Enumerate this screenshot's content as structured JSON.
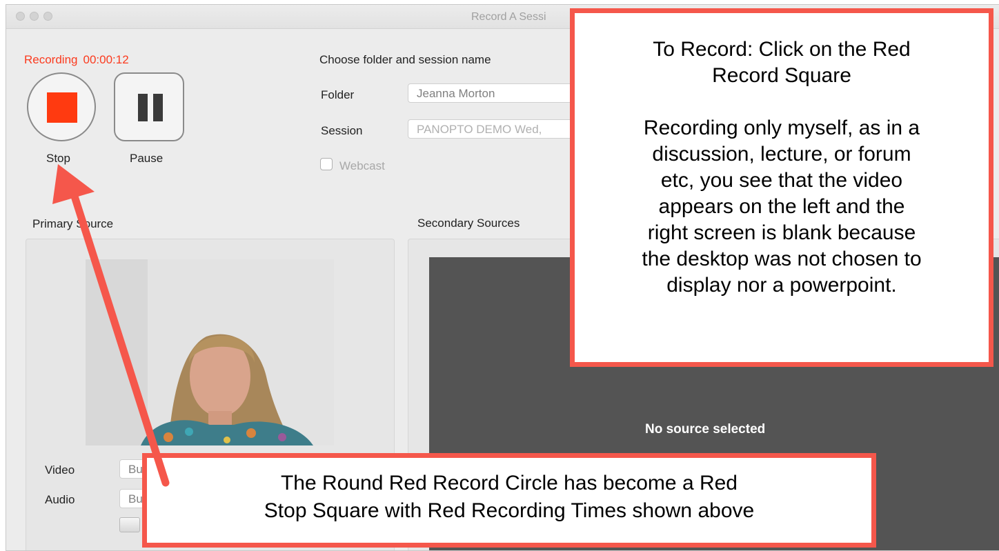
{
  "window": {
    "title": "Record A Sessi"
  },
  "recording": {
    "status_label": "Recording",
    "elapsed_time": "00:00:12",
    "stop_label": "Stop",
    "pause_label": "Pause",
    "accent_color": "#fb3a1e"
  },
  "session": {
    "heading": "Choose folder and session name",
    "folder_label": "Folder",
    "folder_value": "Jeanna Morton",
    "session_label": "Session",
    "session_value": "PANOPTO DEMO Wed,",
    "webcast_label": "Webcast",
    "webcast_checked": false
  },
  "primary": {
    "heading": "Primary Source",
    "video_label": "Video",
    "video_value": "Bu",
    "audio_label": "Audio",
    "audio_value": "Bu"
  },
  "secondary": {
    "heading": "Secondary Sources",
    "empty_text": "No source selected"
  },
  "annotations": {
    "top_right": {
      "line1": "To Record: Click on the Red",
      "line2": "Record Square",
      "line3": "Recording only myself, as in a",
      "line4": "discussion, lecture, or forum",
      "line5": "etc, you see that the video",
      "line6": "appears on the left and the",
      "line7": "right screen is blank because",
      "line8": "the desktop was not chosen to",
      "line9": "display nor a powerpoint."
    },
    "bottom": {
      "line1": "The Round Red Record Circle has become a Red",
      "line2": "Stop Square with Red Recording Times shown above"
    },
    "border_color": "#f5574b"
  }
}
